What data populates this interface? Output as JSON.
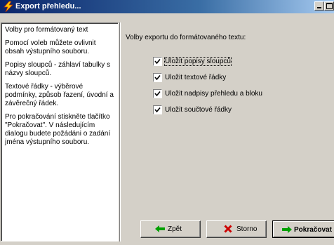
{
  "window": {
    "title": "Export přehledu..."
  },
  "help_panel": {
    "paragraphs": [
      "Volby pro formátovaný text",
      "Pomocí voleb můžete ovlivnit obsah výstupního souboru.",
      "Popisy sloupců - záhlaví tabulky s názvy sloupců.",
      "Textové řádky - výběrové podmínky, způsob řazení, úvodní a závěrečný řádek.",
      "Pro pokračování stiskněte tlačítko \"Pokračovat\". V následujícím dialogu budete požádáni o zadání jména výstupního souboru."
    ]
  },
  "options": {
    "heading": "Volby exportu do formátovaného textu:",
    "items": [
      {
        "label": "Uložit popisy sloupců",
        "checked": true
      },
      {
        "label": "Uložit textové řádky",
        "checked": true
      },
      {
        "label": "Uložit nadpisy přehledu a bloku",
        "checked": true
      },
      {
        "label": "Uložit součtové řádky",
        "checked": true
      }
    ]
  },
  "buttons": {
    "back": "Zpět",
    "cancel": "Storno",
    "next": "Pokračovat"
  },
  "colors": {
    "title_start": "#0a246a",
    "title_end": "#a6caf0",
    "arrow_green": "#00a000",
    "cancel_red": "#cc0000"
  },
  "icons": {
    "app": "lightning-icon",
    "minimize": "minimize-icon",
    "maximize": "maximize-icon",
    "back": "arrow-left-icon",
    "cancel": "x-icon",
    "next": "arrow-right-icon"
  }
}
